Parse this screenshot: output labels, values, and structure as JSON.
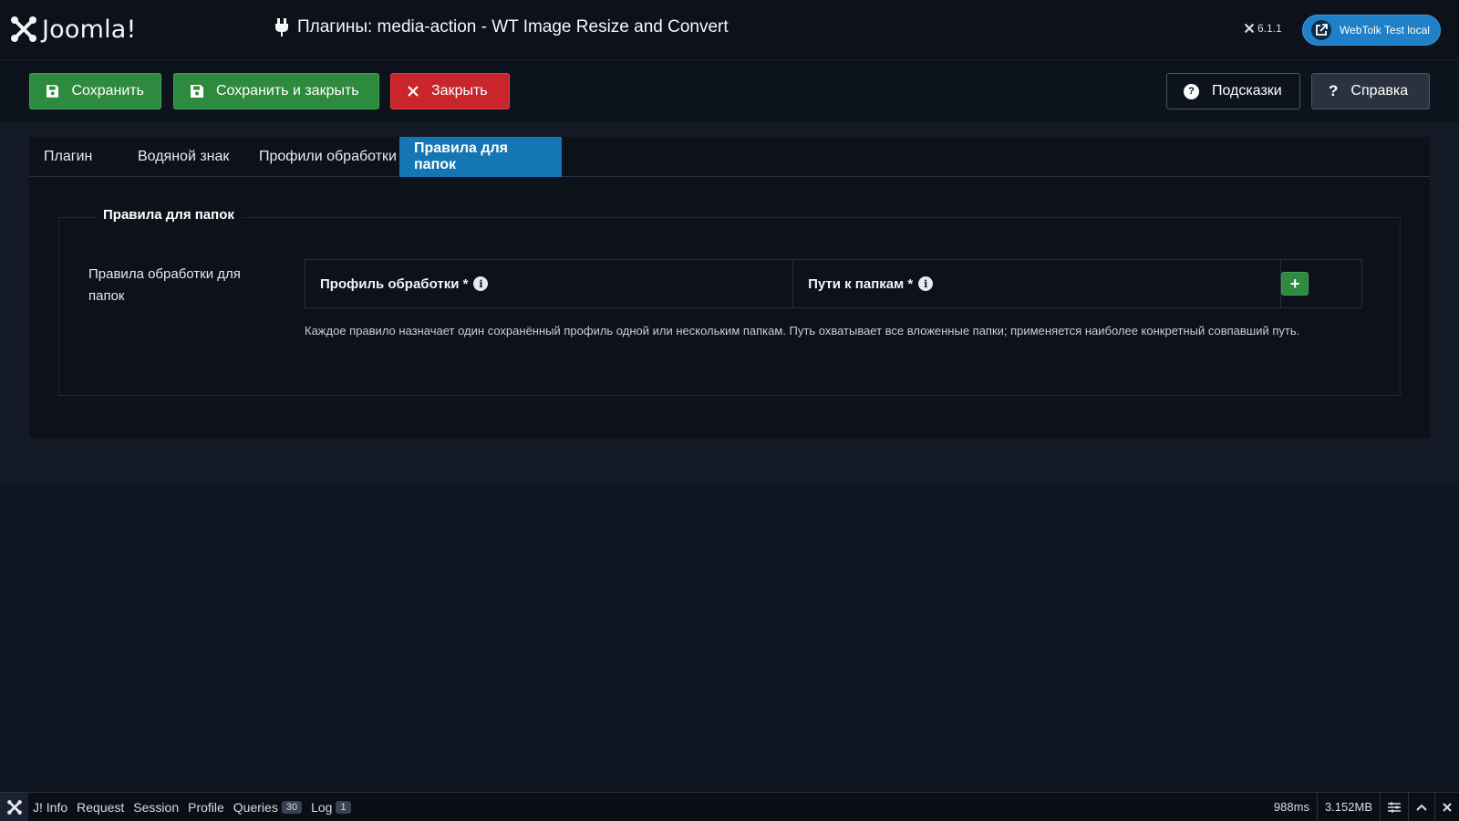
{
  "header": {
    "logo_text": "Joomla!",
    "title": "Плагины: media-action - WT Image Resize and Convert",
    "version": "6.1.1",
    "site_button": "WebTolk Test local"
  },
  "toolbar": {
    "save": "Сохранить",
    "save_close": "Сохранить и закрыть",
    "close": "Закрыть",
    "hints": "Подсказки",
    "help": "Справка"
  },
  "tabs": [
    {
      "label": "Плагин"
    },
    {
      "label": "Водяной знак"
    },
    {
      "label": "Профили обработки"
    },
    {
      "label": "Правила для папок",
      "active": true
    }
  ],
  "fieldset": {
    "legend": "Правила для папок",
    "field_label": "Правила обработки для папок",
    "columns": [
      "Профиль обработки *",
      "Пути к папкам *"
    ],
    "add_button": "+",
    "description": "Каждое правило назначает один сохранённый профиль одной или нескольким папкам. Путь охватывает все вложенные папки; применяется наиболее конкретный совпавший путь."
  },
  "debugbar": {
    "items": [
      {
        "label": "J! Info"
      },
      {
        "label": "Request"
      },
      {
        "label": "Session"
      },
      {
        "label": "Profile"
      },
      {
        "label": "Queries",
        "badge": "30"
      },
      {
        "label": "Log",
        "badge": "1"
      }
    ],
    "time": "988ms",
    "memory": "3.152MB"
  },
  "colors": {
    "accent": "#1477b3",
    "success": "#2e8a3e",
    "danger": "#c8262c",
    "background": "#0f1520"
  }
}
